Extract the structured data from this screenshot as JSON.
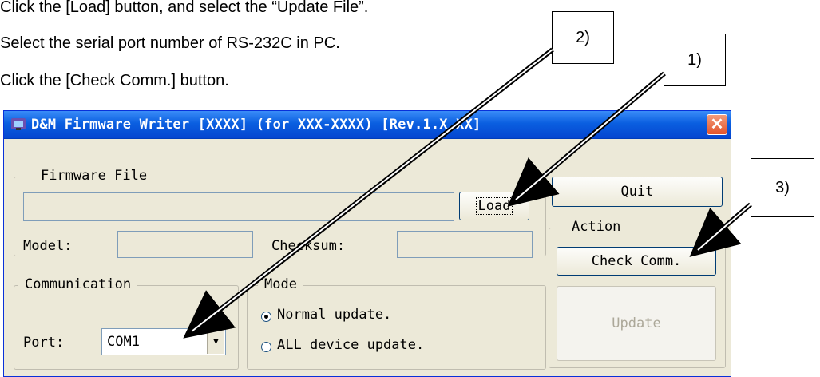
{
  "instructions": [
    "Click the [Load] button, and select the “Update File”.",
    "Select the serial port number of RS-232C in PC.",
    "Click the [Check Comm.] button."
  ],
  "callouts": {
    "c1": "1)",
    "c2": "2)",
    "c3": "3)"
  },
  "window": {
    "title": "D&M Firmware Writer [XXXX] (for XXX-XXXX) [Rev.1.X.XX]",
    "close_icon": "✕"
  },
  "firmware_group": {
    "label": "Firmware File",
    "file_path": "",
    "load_button": "Load",
    "model_label": "Model:",
    "model_value": "",
    "checksum_label": "Checksum:",
    "checksum_value": ""
  },
  "communication_group": {
    "label": "Communication",
    "port_label": "Port:",
    "port_value": "COM1",
    "dropdown_icon": "▼"
  },
  "mode_group": {
    "label": "Mode",
    "options": [
      "Normal update.",
      "ALL device update."
    ],
    "selected": "Normal update."
  },
  "right_panel": {
    "quit_button": "Quit",
    "action_label": "Action",
    "check_comm_button": "Check Comm.",
    "update_button": "Update"
  },
  "colors": {
    "titlebar": "#0a5fe0",
    "window_face": "#ece9d8",
    "close_button": "#e2542c"
  }
}
